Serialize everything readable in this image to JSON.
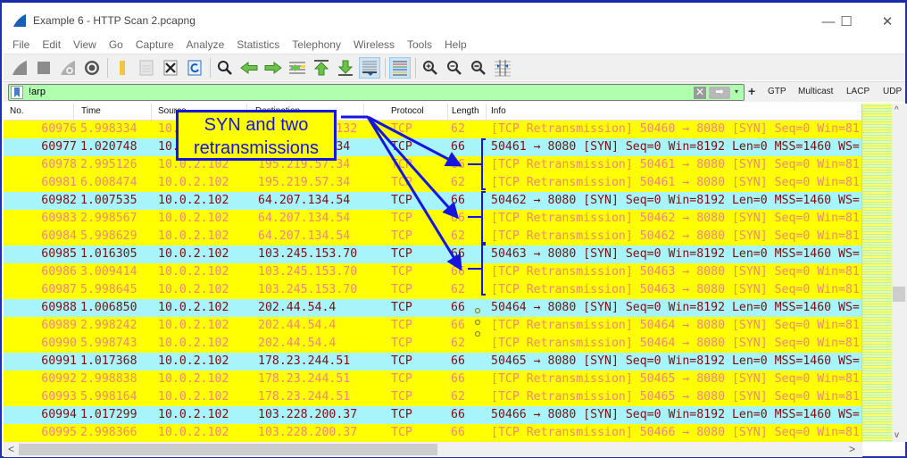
{
  "window": {
    "title": "Example 6 - HTTP Scan 2.pcapng",
    "controls": {
      "minimize": "—",
      "maximize": "☐",
      "close": "✕"
    }
  },
  "menu": [
    "File",
    "Edit",
    "View",
    "Go",
    "Capture",
    "Analyze",
    "Statistics",
    "Telephony",
    "Wireless",
    "Tools",
    "Help"
  ],
  "toolbar": {
    "icons": [
      "start-capture-icon",
      "stop-capture-icon",
      "restart-capture-icon",
      "capture-options-icon",
      "open-file-icon",
      "save-file-icon",
      "close-file-icon",
      "reload-file-icon",
      "find-packet-icon",
      "go-back-icon",
      "go-forward-icon",
      "go-to-packet-icon",
      "first-packet-icon",
      "last-packet-icon",
      "auto-scroll-icon",
      "colorize-icon",
      "zoom-in-icon",
      "zoom-out-icon",
      "normal-size-icon",
      "resize-columns-icon"
    ]
  },
  "filter": {
    "value": "!arp",
    "clear_label": "✕",
    "apply_label": "➡",
    "dropdown_label": "▾",
    "add_label": "+",
    "buttons": [
      "GTP",
      "Multicast",
      "LACP",
      "UDP"
    ]
  },
  "columns": [
    "No.",
    "Time",
    "Source",
    "Destination",
    "Protocol",
    "Length",
    "Info"
  ],
  "packets": [
    {
      "no": "60976",
      "time": "5.998334",
      "src": "10.0.2.102",
      "dst": "195.219.57.132",
      "proto": "TCP",
      "len": "62",
      "info": "[TCP Retransmission] 50460 → 8080 [SYN] Seq=0 Win=81",
      "type": "retr"
    },
    {
      "no": "60977",
      "time": "1.020748",
      "src": "10.0.2.102",
      "dst": "195.219.57.34",
      "proto": "TCP",
      "len": "66",
      "info": "50461 → 8080 [SYN] Seq=0 Win=8192 Len=0 MSS=1460 WS=",
      "type": "syn"
    },
    {
      "no": "60978",
      "time": "2.995126",
      "src": "10.0.2.102",
      "dst": "195.219.57.34",
      "proto": "TCP",
      "len": "66",
      "info": "[TCP Retransmission] 50461 → 8080 [SYN] Seq=0 Win=81",
      "type": "retr"
    },
    {
      "no": "60981",
      "time": "6.008474",
      "src": "10.0.2.102",
      "dst": "195.219.57.34",
      "proto": "TCP",
      "len": "62",
      "info": "[TCP Retransmission] 50461 → 8080 [SYN] Seq=0 Win=81",
      "type": "retr"
    },
    {
      "no": "60982",
      "time": "1.007535",
      "src": "10.0.2.102",
      "dst": "64.207.134.54",
      "proto": "TCP",
      "len": "66",
      "info": "50462 → 8080 [SYN] Seq=0 Win=8192 Len=0 MSS=1460 WS=",
      "type": "syn"
    },
    {
      "no": "60983",
      "time": "2.998567",
      "src": "10.0.2.102",
      "dst": "64.207.134.54",
      "proto": "TCP",
      "len": "66",
      "info": "[TCP Retransmission] 50462 → 8080 [SYN] Seq=0 Win=81",
      "type": "retr"
    },
    {
      "no": "60984",
      "time": "5.998629",
      "src": "10.0.2.102",
      "dst": "64.207.134.54",
      "proto": "TCP",
      "len": "62",
      "info": "[TCP Retransmission] 50462 → 8080 [SYN] Seq=0 Win=81",
      "type": "retr"
    },
    {
      "no": "60985",
      "time": "1.016305",
      "src": "10.0.2.102",
      "dst": "103.245.153.70",
      "proto": "TCP",
      "len": "66",
      "info": "50463 → 8080 [SYN] Seq=0 Win=8192 Len=0 MSS=1460 WS=",
      "type": "syn"
    },
    {
      "no": "60986",
      "time": "3.009414",
      "src": "10.0.2.102",
      "dst": "103.245.153.70",
      "proto": "TCP",
      "len": "66",
      "info": "[TCP Retransmission] 50463 → 8080 [SYN] Seq=0 Win=81",
      "type": "retr"
    },
    {
      "no": "60987",
      "time": "5.998645",
      "src": "10.0.2.102",
      "dst": "103.245.153.70",
      "proto": "TCP",
      "len": "62",
      "info": "[TCP Retransmission] 50463 → 8080 [SYN] Seq=0 Win=81",
      "type": "retr"
    },
    {
      "no": "60988",
      "time": "1.006850",
      "src": "10.0.2.102",
      "dst": "202.44.54.4",
      "proto": "TCP",
      "len": "66",
      "info": "50464 → 8080 [SYN] Seq=0 Win=8192 Len=0 MSS=1460 WS=",
      "type": "syn"
    },
    {
      "no": "60989",
      "time": "2.998242",
      "src": "10.0.2.102",
      "dst": "202.44.54.4",
      "proto": "TCP",
      "len": "66",
      "info": "[TCP Retransmission] 50464 → 8080 [SYN] Seq=0 Win=81",
      "type": "retr"
    },
    {
      "no": "60990",
      "time": "5.998743",
      "src": "10.0.2.102",
      "dst": "202.44.54.4",
      "proto": "TCP",
      "len": "62",
      "info": "[TCP Retransmission] 50464 → 8080 [SYN] Seq=0 Win=81",
      "type": "retr"
    },
    {
      "no": "60991",
      "time": "1.017368",
      "src": "10.0.2.102",
      "dst": "178.23.244.51",
      "proto": "TCP",
      "len": "66",
      "info": "50465 → 8080 [SYN] Seq=0 Win=8192 Len=0 MSS=1460 WS=",
      "type": "syn"
    },
    {
      "no": "60992",
      "time": "2.998838",
      "src": "10.0.2.102",
      "dst": "178.23.244.51",
      "proto": "TCP",
      "len": "66",
      "info": "[TCP Retransmission] 50465 → 8080 [SYN] Seq=0 Win=81",
      "type": "retr"
    },
    {
      "no": "60993",
      "time": "5.998164",
      "src": "10.0.2.102",
      "dst": "178.23.244.51",
      "proto": "TCP",
      "len": "62",
      "info": "[TCP Retransmission] 50465 → 8080 [SYN] Seq=0 Win=81",
      "type": "retr"
    },
    {
      "no": "60994",
      "time": "1.017299",
      "src": "10.0.2.102",
      "dst": "103.228.200.37",
      "proto": "TCP",
      "len": "66",
      "info": "50466 → 8080 [SYN] Seq=0 Win=8192 Len=0 MSS=1460 WS=",
      "type": "syn"
    },
    {
      "no": "60995",
      "time": "2.998366",
      "src": "10.0.2.102",
      "dst": "103.228.200.37",
      "proto": "TCP",
      "len": "66",
      "info": "[TCP Retransmission] 50466 → 8080 [SYN] Seq=0 Win=81",
      "type": "retr"
    }
  ],
  "annotation": {
    "line1": "SYN and two",
    "line2": "retransmissions",
    "color": "#1515e0",
    "background": "#ffff00"
  },
  "colors": {
    "syn_row_bg": "#a8f4fb",
    "syn_row_fg": "#7c1010",
    "retr_row_bg": "#ffff00",
    "retr_row_fg": "#f0877c",
    "filter_bg": "#afffaf"
  },
  "scroll": {
    "left_arrow": "<",
    "right_arrow": ">",
    "up_arrow": "^",
    "down_arrow": "v"
  }
}
